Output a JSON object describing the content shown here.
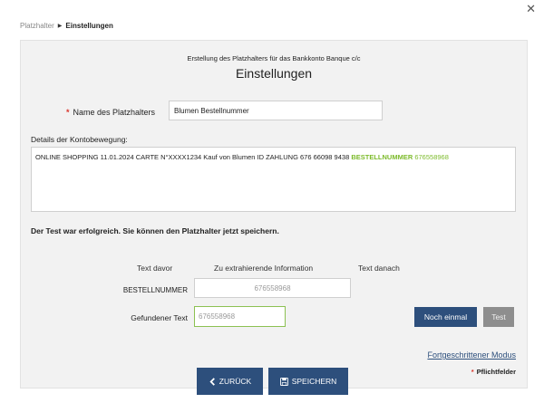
{
  "breadcrumb": {
    "parent": "Platzhalter",
    "current": "Einstellungen"
  },
  "dialog": {
    "subtitle": "Erstellung des Platzhalters für das Bankkonto Banque c/c",
    "title": "Einstellungen"
  },
  "form": {
    "name_label": "Name des Platzhalters",
    "name_value": "Blumen Bestellnummer",
    "details_label": "Details der Kontobewegung:",
    "details_text": "ONLINE SHOPPING 11.01.2024 CARTE N°XXXX1234 Kauf von Blumen ID ZAHLUNG 676 66098 9438 ",
    "details_highlight_key": "BESTELLNUMMER",
    "details_highlight_value": " 676558968"
  },
  "test": {
    "success_message": "Der Test war erfolgreich. Sie können den Platzhalter jetzt speichern.",
    "col_before": "Text davor",
    "col_extract": "Zu extrahierende Information",
    "col_after": "Text danach",
    "before_value": "BESTELLNUMMER",
    "extract_value": "676558968",
    "found_label": "Gefundener Text",
    "found_value": "676558968",
    "again_label": "Noch einmal",
    "test_label": "Test"
  },
  "footer": {
    "advanced_link": "Fortgeschrittener Modus",
    "required_note": "Pflichtfelder",
    "back_label": "ZURÜCK",
    "save_label": "SPEICHERN"
  },
  "colors": {
    "primary": "#2d4f7c",
    "highlight_green": "#7dbb2c",
    "required_red": "#d9342b"
  }
}
